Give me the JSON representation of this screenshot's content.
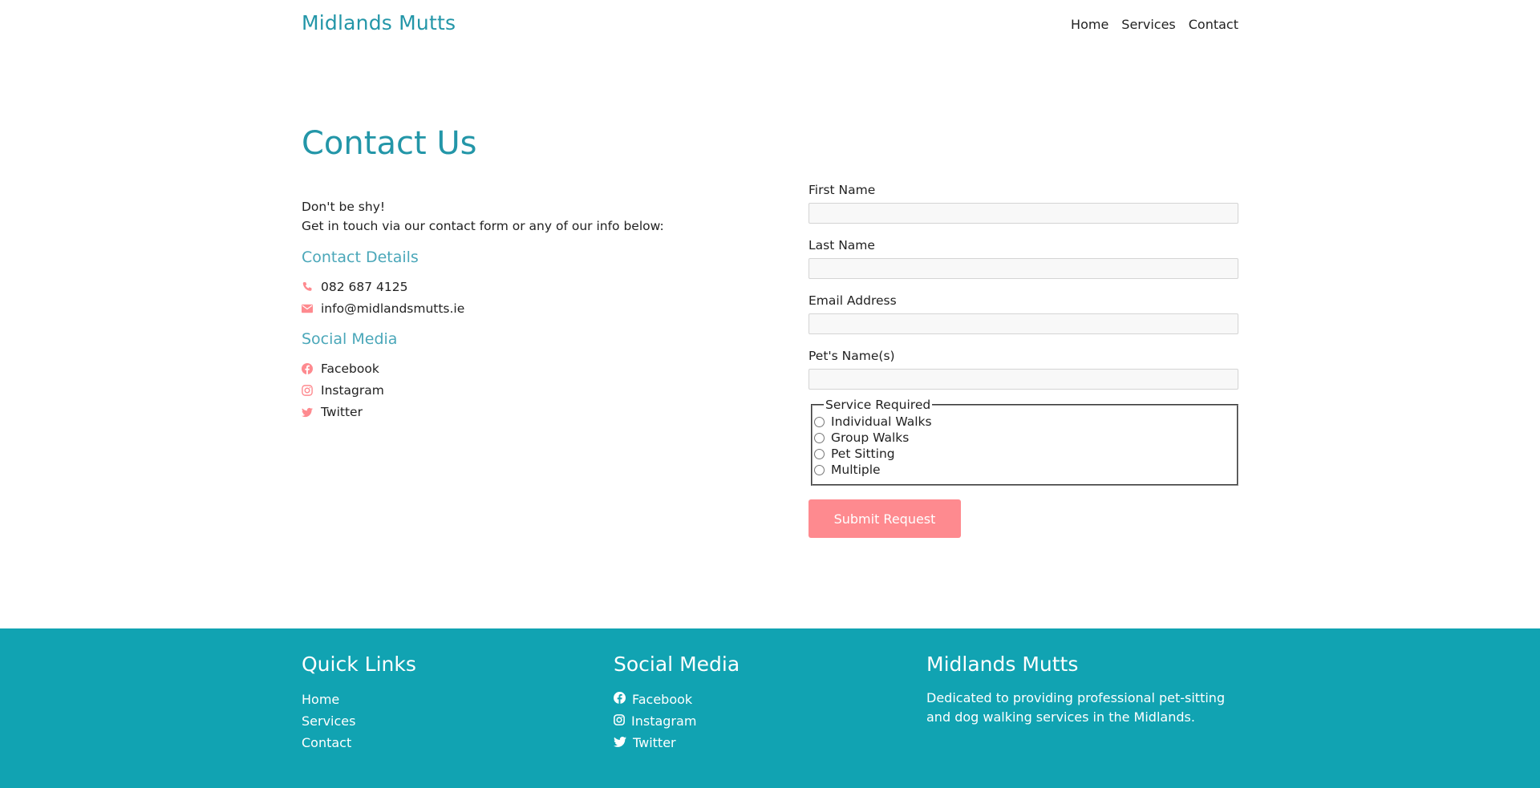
{
  "header": {
    "brand": "Midlands Mutts",
    "nav": [
      "Home",
      "Services",
      "Contact"
    ]
  },
  "main": {
    "title": "Contact Us",
    "intro_line1": "Don't be shy!",
    "intro_line2": "Get in touch via our contact form or any of our info below:",
    "contact_details_heading": "Contact Details",
    "phone": "082 687 4125",
    "email": "info@midlandsmutts.ie",
    "social_heading": "Social Media",
    "social": [
      "Facebook",
      "Instagram",
      "Twitter"
    ]
  },
  "form": {
    "first_name_label": "First Name",
    "last_name_label": "Last Name",
    "email_label": "Email Address",
    "pet_name_label": "Pet's Name(s)",
    "service_legend": "Service Required",
    "services": [
      "Individual Walks",
      "Group Walks",
      "Pet Sitting",
      "Multiple"
    ],
    "submit_label": "Submit Request"
  },
  "footer": {
    "quick_links_heading": "Quick Links",
    "quick_links": [
      "Home",
      "Services",
      "Contact"
    ],
    "social_heading": "Social Media",
    "social": [
      "Facebook",
      "Instagram",
      "Twitter"
    ],
    "about_heading": "Midlands Mutts",
    "about_text": "Dedicated to providing professional pet-sitting and dog walking services in the Midlands."
  },
  "colors": {
    "brand_teal": "#2396a8",
    "accent_pink": "#fe8a8f",
    "footer_bg": "#11a3b2"
  },
  "icons": [
    "phone-icon",
    "envelope-icon",
    "facebook-icon",
    "instagram-icon",
    "twitter-icon"
  ]
}
